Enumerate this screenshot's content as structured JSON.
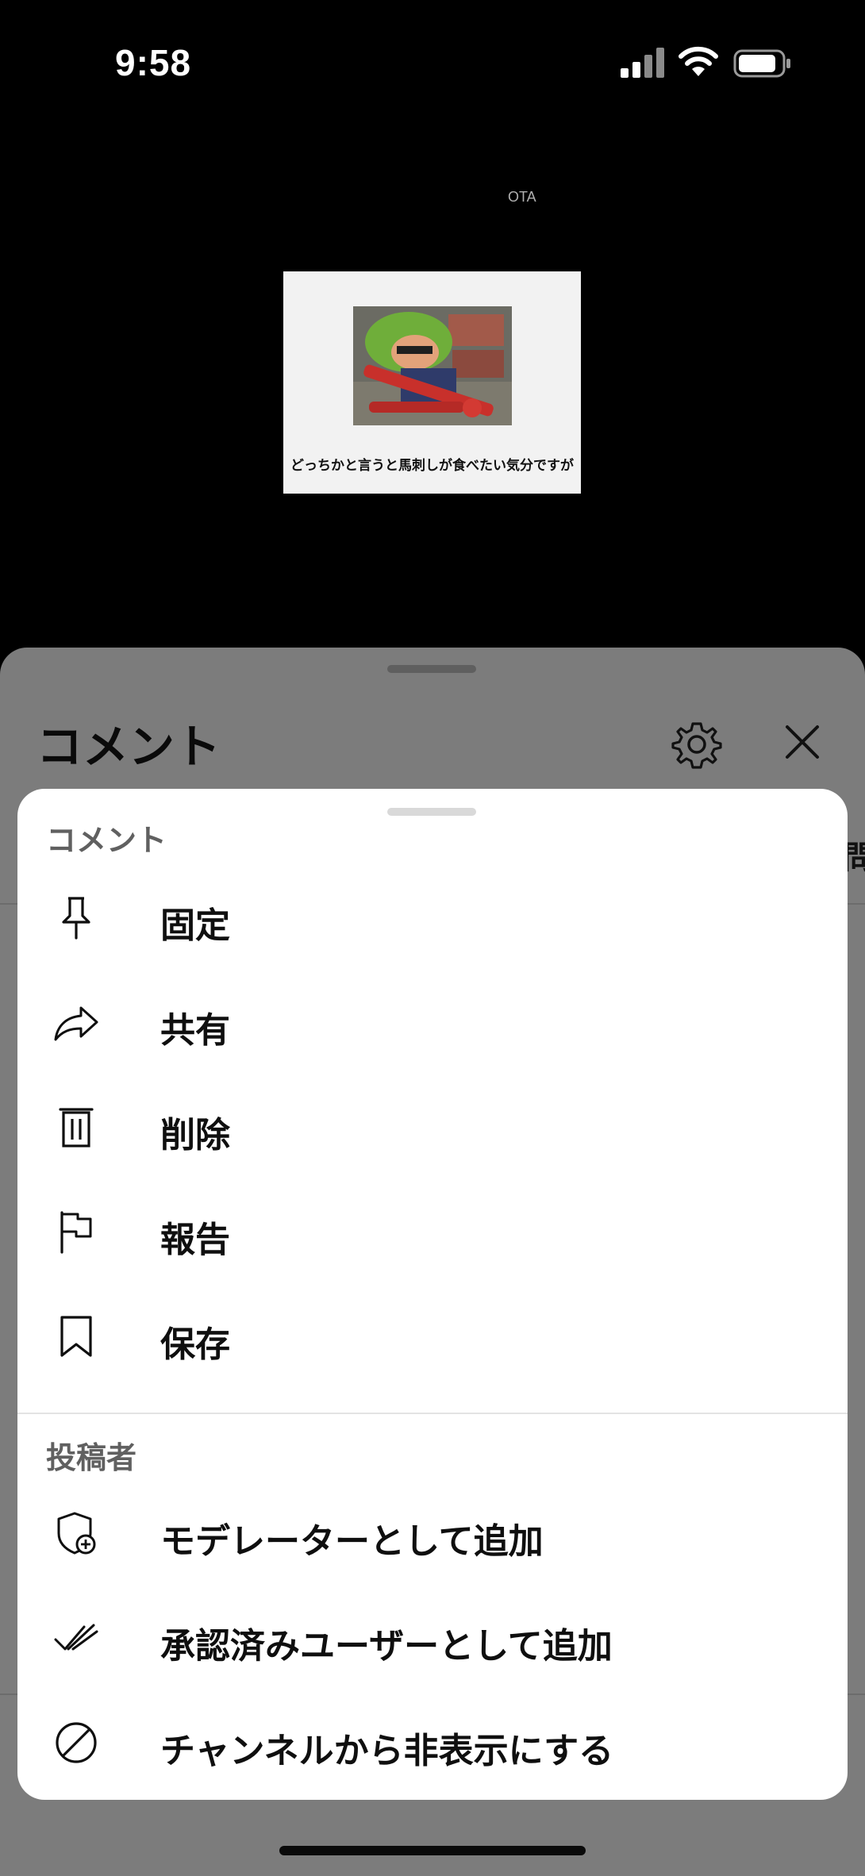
{
  "status_bar": {
    "time": "9:58",
    "icons": [
      "cellular-signal-icon",
      "wifi-icon",
      "battery-icon"
    ]
  },
  "video": {
    "watermark": "OTA",
    "thumbnail_caption": "どっちかと言うと馬刺しが食べたい気分ですが"
  },
  "comments_panel": {
    "title": "コメント",
    "edge_text": "問",
    "icons": [
      "gear-icon",
      "close-icon"
    ]
  },
  "menu": {
    "section_comment": "コメント",
    "comment_items": [
      {
        "label": "固定",
        "icon": "pin-icon"
      },
      {
        "label": "共有",
        "icon": "share-icon"
      },
      {
        "label": "削除",
        "icon": "trash-icon"
      },
      {
        "label": "報告",
        "icon": "flag-icon"
      },
      {
        "label": "保存",
        "icon": "bookmark-icon"
      }
    ],
    "section_author": "投稿者",
    "author_items": [
      {
        "label": "モデレーターとして追加",
        "icon": "shield-add-icon"
      },
      {
        "label": "承認済みユーザーとして追加",
        "icon": "double-check-icon"
      },
      {
        "label": "チャンネルから非表示にする",
        "icon": "block-icon"
      }
    ]
  },
  "colors": {
    "menu_background": "#ffffff",
    "dimmed_sheet": "#7c7c7c",
    "section_label": "#606060",
    "text": "#0f0f0f"
  }
}
